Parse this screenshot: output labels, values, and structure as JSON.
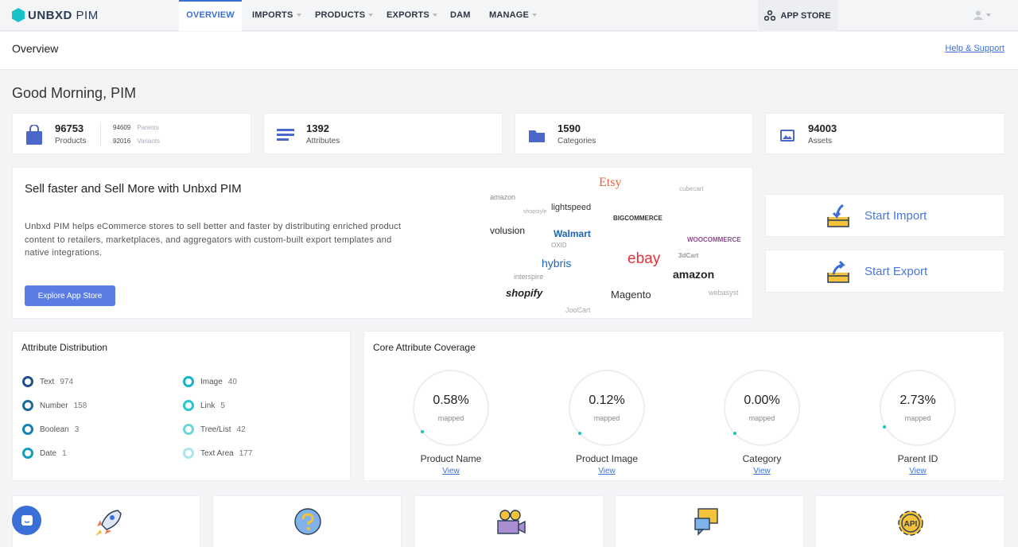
{
  "brand": {
    "name": "UNBXD",
    "product": "PIM",
    "color": "#17c2c9"
  },
  "nav": {
    "tabs": [
      {
        "label": "OVERVIEW",
        "active": true
      },
      {
        "label": "IMPORTS",
        "dropdown": true
      },
      {
        "label": "PRODUCTS",
        "dropdown": true
      },
      {
        "label": "EXPORTS",
        "dropdown": true
      },
      {
        "label": "DAM"
      },
      {
        "label": "MANAGE",
        "dropdown": true
      }
    ],
    "app_store": "APP STORE",
    "accent": "#3b6fd8"
  },
  "subheader": {
    "title": "Overview",
    "help": "Help & Support"
  },
  "greeting": "Good Morning, PIM",
  "stats": [
    {
      "value": "96753",
      "label": "Products",
      "icon": "shopping-bag-icon",
      "parents": {
        "value": "94609",
        "label": "Parents"
      },
      "variants": {
        "value": "92016",
        "label": "Variants"
      }
    },
    {
      "value": "1392",
      "label": "Attributes",
      "icon": "list-icon"
    },
    {
      "value": "1590",
      "label": "Categories",
      "icon": "folder-icon"
    },
    {
      "value": "94003",
      "label": "Assets",
      "icon": "image-icon"
    }
  ],
  "promo": {
    "title": "Sell faster and Sell More with Unbxd PIM",
    "body": "Unbxd PIM helps eCommerce stores to sell better and faster by distributing enriched product content to retailers, marketplaces, and aggregators with custom-built export templates and native integrations.",
    "button": "Explore App Store",
    "logos": [
      "Etsy",
      "amazon",
      "lightspeed",
      "BIGCOMMERCE",
      "volusion",
      "Walmart",
      "WOOCOMMERCE",
      "hybris",
      "ebay",
      "amazon",
      "shopify",
      "Magento",
      "interspire",
      "3dCart",
      "JooCart",
      "webasyst",
      "cubecart",
      "shopstyle",
      "OXID"
    ]
  },
  "actions": {
    "import": "Start Import",
    "export": "Start Export"
  },
  "attribute_distribution": {
    "title": "Attribute Distribution",
    "items": [
      {
        "label": "Text",
        "value": "974",
        "color": "#1d4f8a"
      },
      {
        "label": "Number",
        "value": "158",
        "color": "#1b6a9c"
      },
      {
        "label": "Boolean",
        "value": "3",
        "color": "#1582ad"
      },
      {
        "label": "Date",
        "value": "1",
        "color": "#159dbd"
      },
      {
        "label": "Image",
        "value": "40",
        "color": "#15b5c9"
      },
      {
        "label": "Link",
        "value": "5",
        "color": "#2cc6d3"
      },
      {
        "label": "Tree/List",
        "value": "42",
        "color": "#6fd6dd"
      },
      {
        "label": "Text Area",
        "value": "177",
        "color": "#a9e6ea"
      }
    ]
  },
  "core_coverage": {
    "title": "Core Attribute Coverage",
    "mapped_label": "mapped",
    "view_label": "View",
    "items": [
      {
        "name": "Product Name",
        "pct": "0.58%",
        "fraction": 0.0058
      },
      {
        "name": "Product Image",
        "pct": "0.12%",
        "fraction": 0.0012
      },
      {
        "name": "Category",
        "pct": "0.00%",
        "fraction": 0
      },
      {
        "name": "Parent ID",
        "pct": "2.73%",
        "fraction": 0.0273
      }
    ]
  },
  "bottom_cards": [
    "rocket-icon",
    "question-icon",
    "video-camera-icon",
    "chat-bubbles-icon",
    "api-gear-icon"
  ]
}
